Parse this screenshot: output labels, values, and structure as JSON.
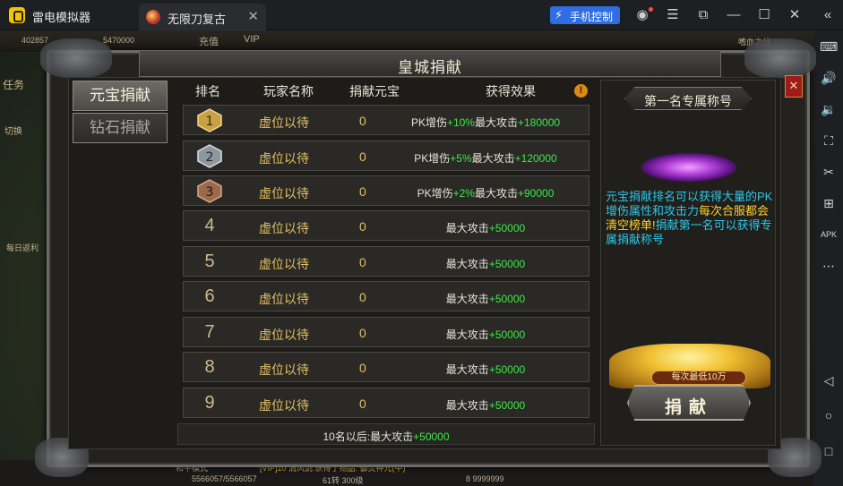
{
  "emulator": {
    "app_name": "雷电模拟器",
    "tab_title": "无限刀复古",
    "tab_close": "✕",
    "phone_control": "手机控制"
  },
  "game_hud": {
    "top_left_value": "402857",
    "top_value": "5470000",
    "recharge": "充值",
    "vip": "VIP",
    "top_right": "嗜血之战",
    "task": "任务",
    "switch": "切换",
    "daily_rebate": "每日返利",
    "peace_mode": "和平模式",
    "chat_line": "[VIP]10 清风剑:获得了物品: 御灵神元(中)",
    "stat_hp": "5566057/5566057",
    "stat_level": "61转 300级",
    "stat_gold": "8 9999999"
  },
  "panel": {
    "title": "皇城捐献",
    "close": "✕",
    "tabs": [
      {
        "label": "元宝捐献",
        "active": true
      },
      {
        "label": "钻石捐献",
        "active": false
      }
    ],
    "columns": {
      "rank": "排名",
      "player": "玩家名称",
      "amount": "捐献元宝",
      "effect": "获得效果"
    },
    "warn_icon": "!",
    "rows": [
      {
        "rank": "1",
        "player": "虚位以待",
        "amount": "0",
        "effect_pre": "PK增伤",
        "effect_pk": "+10%",
        "effect_mid": "最大攻击",
        "effect_atk": "+180000"
      },
      {
        "rank": "2",
        "player": "虚位以待",
        "amount": "0",
        "effect_pre": "PK增伤",
        "effect_pk": "+5%",
        "effect_mid": "最大攻击",
        "effect_atk": "+120000"
      },
      {
        "rank": "3",
        "player": "虚位以待",
        "amount": "0",
        "effect_pre": "PK增伤",
        "effect_pk": "+2%",
        "effect_mid": "最大攻击",
        "effect_atk": "+90000"
      },
      {
        "rank": "4",
        "player": "虚位以待",
        "amount": "0",
        "effect_pre": "",
        "effect_pk": "",
        "effect_mid": "最大攻击",
        "effect_atk": "+50000"
      },
      {
        "rank": "5",
        "player": "虚位以待",
        "amount": "0",
        "effect_pre": "",
        "effect_pk": "",
        "effect_mid": "最大攻击",
        "effect_atk": "+50000"
      },
      {
        "rank": "6",
        "player": "虚位以待",
        "amount": "0",
        "effect_pre": "",
        "effect_pk": "",
        "effect_mid": "最大攻击",
        "effect_atk": "+50000"
      },
      {
        "rank": "7",
        "player": "虚位以待",
        "amount": "0",
        "effect_pre": "",
        "effect_pk": "",
        "effect_mid": "最大攻击",
        "effect_atk": "+50000"
      },
      {
        "rank": "8",
        "player": "虚位以待",
        "amount": "0",
        "effect_pre": "",
        "effect_pk": "",
        "effect_mid": "最大攻击",
        "effect_atk": "+50000"
      },
      {
        "rank": "9",
        "player": "虚位以待",
        "amount": "0",
        "effect_pre": "",
        "effect_pk": "",
        "effect_mid": "最大攻击",
        "effect_atk": "+50000"
      }
    ],
    "footer": {
      "text": "10名以后:最大攻击",
      "value": "+50000"
    },
    "right": {
      "title_label": "第一名专属称号",
      "desc_a": "元宝捐献排名可以获得大量的PK增伤属性和攻击力",
      "desc_b": "每次合服都会清空榜单!",
      "desc_c": "捐献第一名可以获得专属捐献称号",
      "gold_label": "每次最低10万",
      "donate_button": "捐献"
    }
  },
  "colors": {
    "accent_blue": "#2f6de1",
    "text_gold": "#e3c063",
    "text_green": "#3ee84a",
    "text_cyan": "#2ec7e6",
    "text_yellow": "#ffd32e"
  }
}
